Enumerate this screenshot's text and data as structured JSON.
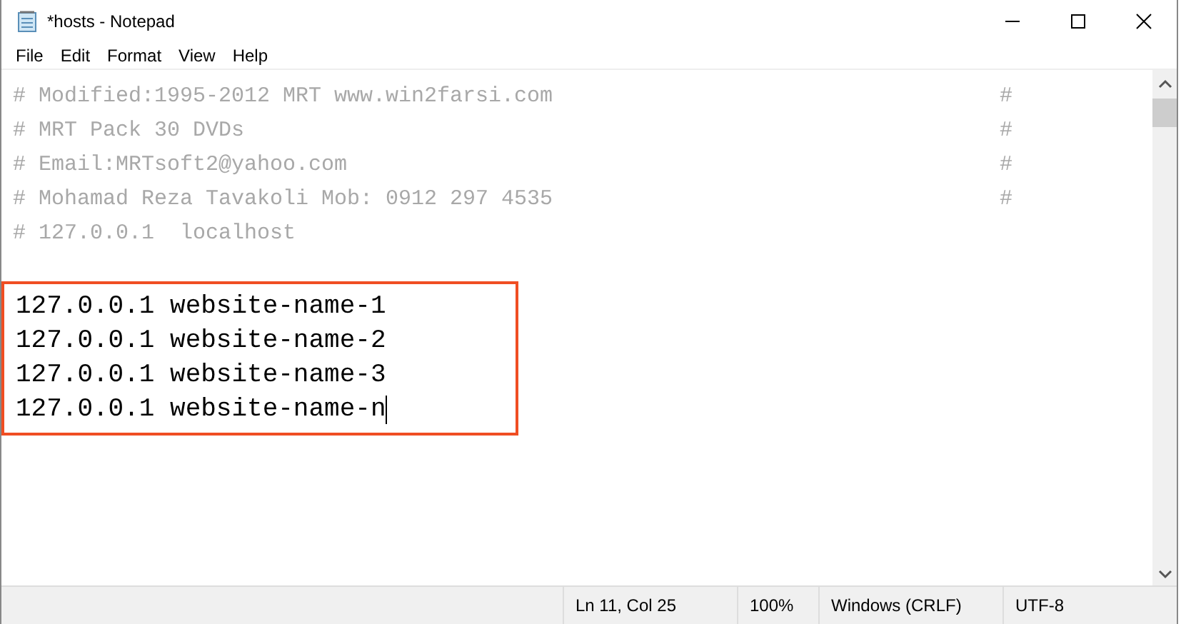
{
  "window": {
    "title": "*hosts - Notepad"
  },
  "menu": [
    "File",
    "Edit",
    "Format",
    "View",
    "Help"
  ],
  "comment_lines": [
    {
      "text": "# Modified:1995-2012 MRT www.win2farsi.com",
      "mark": "#"
    },
    {
      "text": "# MRT Pack 30 DVDs",
      "mark": "#"
    },
    {
      "text": "# Email:MRTsoft2@yahoo.com",
      "mark": "#"
    },
    {
      "text": "# Mohamad Reza Tavakoli Mob: 0912 297 4535",
      "mark": "#"
    },
    {
      "text": "# 127.0.0.1  localhost"
    }
  ],
  "entries": {
    "highlighted": true,
    "caret": true,
    "lines": [
      "127.0.0.1 website-name-1",
      "127.0.0.1 website-name-2",
      "127.0.0.1 website-name-3",
      "127.0.0.1 website-name-n"
    ]
  },
  "status_bar": {
    "position": "Ln 11, Col 25",
    "zoom": "100%",
    "line_ending": "Windows (CRLF)",
    "encoding": "UTF-8"
  }
}
